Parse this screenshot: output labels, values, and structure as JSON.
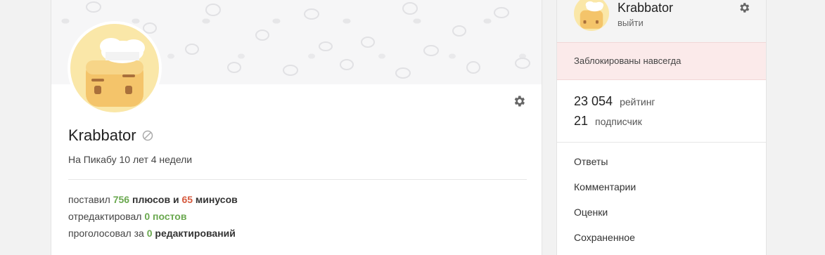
{
  "profile": {
    "username": "Krabbator",
    "tenure": {
      "prefix": "На Пикабу 10 лет",
      "weeks": "4",
      "suffix": " недели"
    },
    "stats": {
      "line1": {
        "a": "поставил ",
        "plus": "756",
        "b": " плюсов",
        "c": " и ",
        "minus": "65",
        "d": " минусов"
      },
      "line2": {
        "a": "отредактировал ",
        "b": "0 постов"
      },
      "line3": {
        "a": "проголосовал за ",
        "n": "0",
        "b": " редактирований"
      }
    }
  },
  "sidebar": {
    "username": "Krabbator",
    "logout": "выйти",
    "banned": "Заблокированы навсегда",
    "rating": {
      "value": "23 054",
      "label": "рейтинг"
    },
    "subscribers": {
      "value": "21",
      "label": "подписчик"
    },
    "menu": [
      "Ответы",
      "Комментарии",
      "Оценки",
      "Сохраненное"
    ]
  },
  "colors": {
    "plus": "#6aa84f",
    "minus": "#d65a3e",
    "banned_bg": "#fbeaea"
  },
  "icons": [
    "gear-icon",
    "ban-icon"
  ]
}
